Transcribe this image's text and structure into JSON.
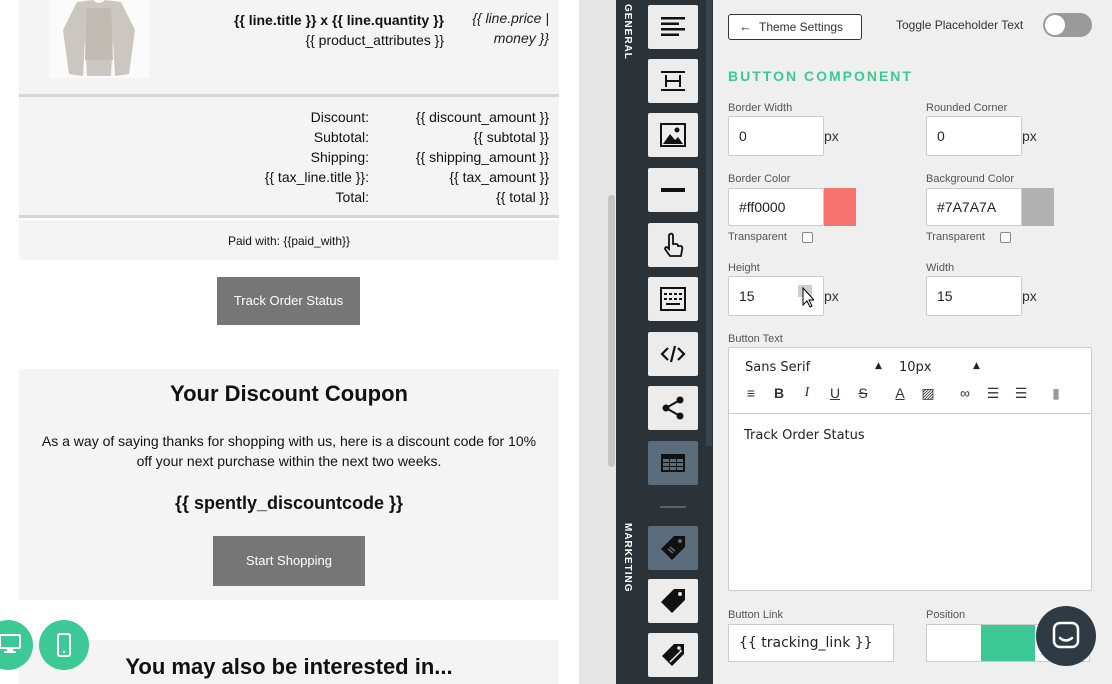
{
  "email": {
    "line_title": "{{ line.title }} x {{ line.quantity }}",
    "line_attributes": "{{ product_attributes }}",
    "line_price_1": "{{ line.price |",
    "line_price_2": "money }}",
    "totals": [
      {
        "label": "Discount:",
        "value": "{{ discount_amount }}"
      },
      {
        "label": "Subtotal:",
        "value": "{{ subtotal }}"
      },
      {
        "label": "Shipping:",
        "value": "{{ shipping_amount }}"
      },
      {
        "label": "{{ tax_line.title }}:",
        "value": "{{ tax_amount }}"
      },
      {
        "label": "Total:",
        "value": "{{ total }}"
      }
    ],
    "paid_with": "Paid with: {{paid_with}}",
    "track_button": "Track Order Status",
    "coupon_title": "Your Discount Coupon",
    "coupon_desc": "As a way of saying thanks for shopping with us, here is a discount code for 10% off your next purchase within the next two weeks.",
    "coupon_code": "{{ spently_discountcode }}",
    "shop_button": "Start Shopping",
    "more_title": "You may also be interested in..."
  },
  "sidebar": {
    "general_label": "GENERAL",
    "marketing_label": "MARKETING",
    "tools": [
      "text-align-icon",
      "divider-layout-icon",
      "image-icon",
      "line-icon",
      "button-hand-icon",
      "keyboard-icon",
      "code-icon",
      "share-icon",
      "table-icon"
    ],
    "marketing_tools": [
      "coupon-tag-icon",
      "tag-icon",
      "tags-icon"
    ]
  },
  "panel": {
    "theme_button": "Theme Settings",
    "toggle_label": "Toggle Placeholder Text",
    "section_title": "BUTTON COMPONENT",
    "border_width": {
      "label": "Border Width",
      "value": "0",
      "unit": "px"
    },
    "rounded_corner": {
      "label": "Rounded Corner",
      "value": "0",
      "unit": "px"
    },
    "border_color": {
      "label": "Border Color",
      "value": "#ff0000",
      "swatch": "#f77470"
    },
    "background_color": {
      "label": "Background Color",
      "value": "#7A7A7A",
      "swatch": "#b1b1b1"
    },
    "transparent_label": "Transparent",
    "height": {
      "label": "Height",
      "value": "15",
      "unit": "px"
    },
    "width": {
      "label": "Width",
      "value": "15",
      "unit": "px"
    },
    "button_text_label": "Button Text",
    "font_family": "Sans Serif",
    "font_size": "10px",
    "editor_text": "Track Order Status",
    "button_link_label": "Button Link",
    "button_link_value": "{{ tracking_link }}",
    "position_label": "Position"
  },
  "colors": {
    "accent": "#3dc995",
    "sidebar_bg": "#2b3339",
    "button_gray": "#767676"
  }
}
